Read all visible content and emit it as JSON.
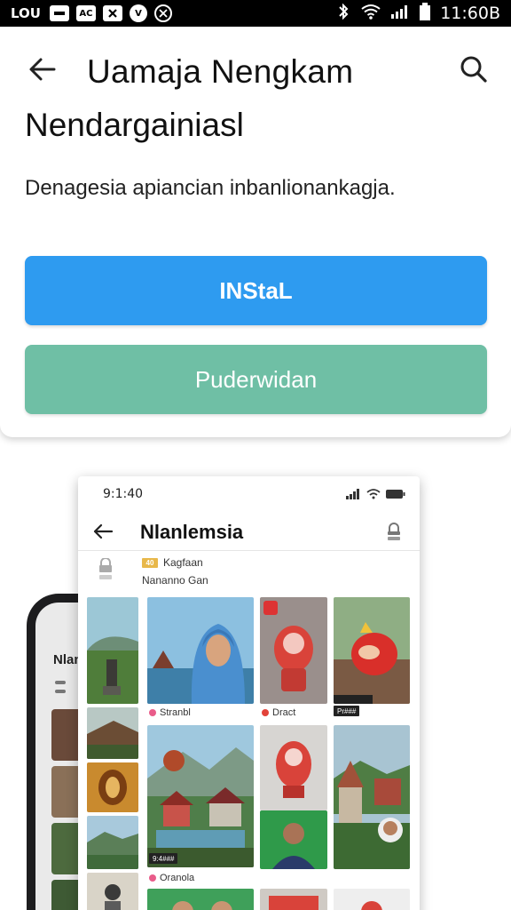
{
  "status_bar": {
    "carrier": "LOU",
    "icons": [
      {
        "name": "sim-icon",
        "label": ""
      },
      {
        "name": "app-notification-icon",
        "label": "AC"
      },
      {
        "name": "x-notification-icon",
        "label": "X"
      },
      {
        "name": "v-notification-icon",
        "label": "V"
      },
      {
        "name": "twitter-notification-icon",
        "label": "X"
      }
    ],
    "time": "11:60B"
  },
  "app": {
    "title_line1": "Uamaja Nengkam",
    "title_line2": "Nendargainiasl",
    "description": "Denagesia apiancian inbanlionankagja.",
    "install_label": "INStaL",
    "secondary_label": "Puderwidan"
  },
  "screenshot": {
    "time": "9:1:40",
    "title": "Nlanlemsia",
    "badge": "40",
    "subtitle1": "Kagfaan",
    "subtitle2": "Nananno Gan",
    "captions": {
      "c1": "Stranbl",
      "c2": "Dract",
      "c3": "Oranola"
    },
    "tags": {
      "t1": "Pr###",
      "t2": "9:4###"
    }
  },
  "back_phone": {
    "title": "Nlan"
  },
  "colors": {
    "install": "#2e9bf0",
    "secondary": "#6fbfa5",
    "badge": "#e8b84a"
  }
}
